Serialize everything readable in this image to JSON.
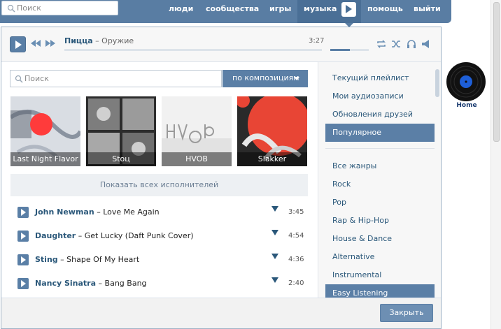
{
  "topnav": {
    "search_placeholder": "Поиск",
    "items": [
      "люди",
      "сообщества",
      "игры",
      "музыка",
      "помощь",
      "выйти"
    ]
  },
  "player": {
    "artist": "Пицца",
    "separator": "–",
    "song": "Оружие",
    "time": "3:27",
    "progress_fraction": 0.0,
    "volume_fraction": 0.5
  },
  "search": {
    "placeholder": "Поиск",
    "mode_label": "по композициям"
  },
  "artists": [
    {
      "label": "Last Night Flavor"
    },
    {
      "label": "Stoц"
    },
    {
      "label": "HVOB"
    },
    {
      "label": "Slakker"
    }
  ],
  "show_all_label": "Показать всех исполнителей",
  "tracks": [
    {
      "artist": "John Newman",
      "title": "Love Me Again",
      "duration": "3:45"
    },
    {
      "artist": "Daughter",
      "title": "Get Lucky (Daft Punk Cover)",
      "duration": "4:54"
    },
    {
      "artist": "Sting",
      "title": "Shape Of My Heart",
      "duration": "4:36"
    },
    {
      "artist": "Nancy Sinatra",
      "title": "Bang Bang",
      "duration": "2:40"
    }
  ],
  "track_separator": "–",
  "sidebar": {
    "top_items": [
      "Текущий плейлист",
      "Мои аудиозаписи",
      "Обновления друзей",
      "Популярное"
    ],
    "genres": [
      "Все жанры",
      "Rock",
      "Pop",
      "Rap & Hip-Hop",
      "House & Dance",
      "Alternative",
      "Instrumental",
      "Easy Listening"
    ]
  },
  "close_label": "Закрыть",
  "desktop": {
    "home_label": "Home"
  },
  "colors": {
    "brand": "#597da3",
    "accent": "#5b7fa6",
    "link": "#2b587a"
  }
}
